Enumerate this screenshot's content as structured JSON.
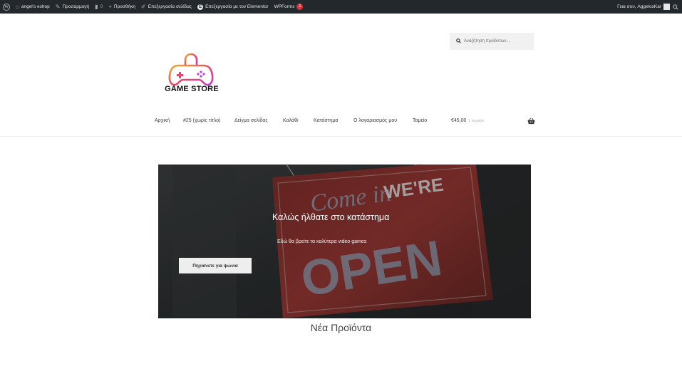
{
  "adminbar": {
    "site_name": "angel's eshop",
    "customize": "Προσαρμογή",
    "comments_count": "0",
    "new": "Προσθήκη",
    "edit_page": "Επεξεργασία σελίδας",
    "edit_elementor": "Επεξεργασία με τον Elementor",
    "wpforms": "WPForms",
    "wpforms_badge": "1",
    "greeting": "Γεια σου, AggelosKar"
  },
  "header": {
    "search_placeholder": "Αναζήτηση προϊόντων...",
    "logo_text": "GAME STORE"
  },
  "nav": {
    "items": [
      "Αρχική",
      "#25 (χωρίς τίτλο)",
      "Δείγμα σελίδας",
      "Καλάθι",
      "Κατάστημα",
      "Ο λογαριασμός μου",
      "Ταμείο"
    ],
    "cart_price": "€45,00",
    "cart_count": "1 προϊόν"
  },
  "hero": {
    "title": "Καλώς ήλθατε στο κατάστημα",
    "subtitle": "Εδώ θα βρείτε τα καλύτερα video games",
    "button": "Πηγαίνετε για ψώνια",
    "sign_line1": "Come in",
    "sign_line2": "WE'RE",
    "sign_line3": "OPEN"
  },
  "main": {
    "section_title": "Νέα Προϊόντα"
  },
  "colors": {
    "adminbar": "#23282d",
    "badge": "#d63638",
    "logo_gradient_start": "#f0b02c",
    "logo_gradient_end": "#d13ad0",
    "sign_red": "#8c2f2c"
  },
  "icons": [
    "wordpress-icon",
    "home-icon",
    "brush-icon",
    "comment-icon",
    "plus-icon",
    "pencil-icon",
    "elementor-icon",
    "search-icon",
    "basket-icon",
    "gamepad-logo"
  ]
}
